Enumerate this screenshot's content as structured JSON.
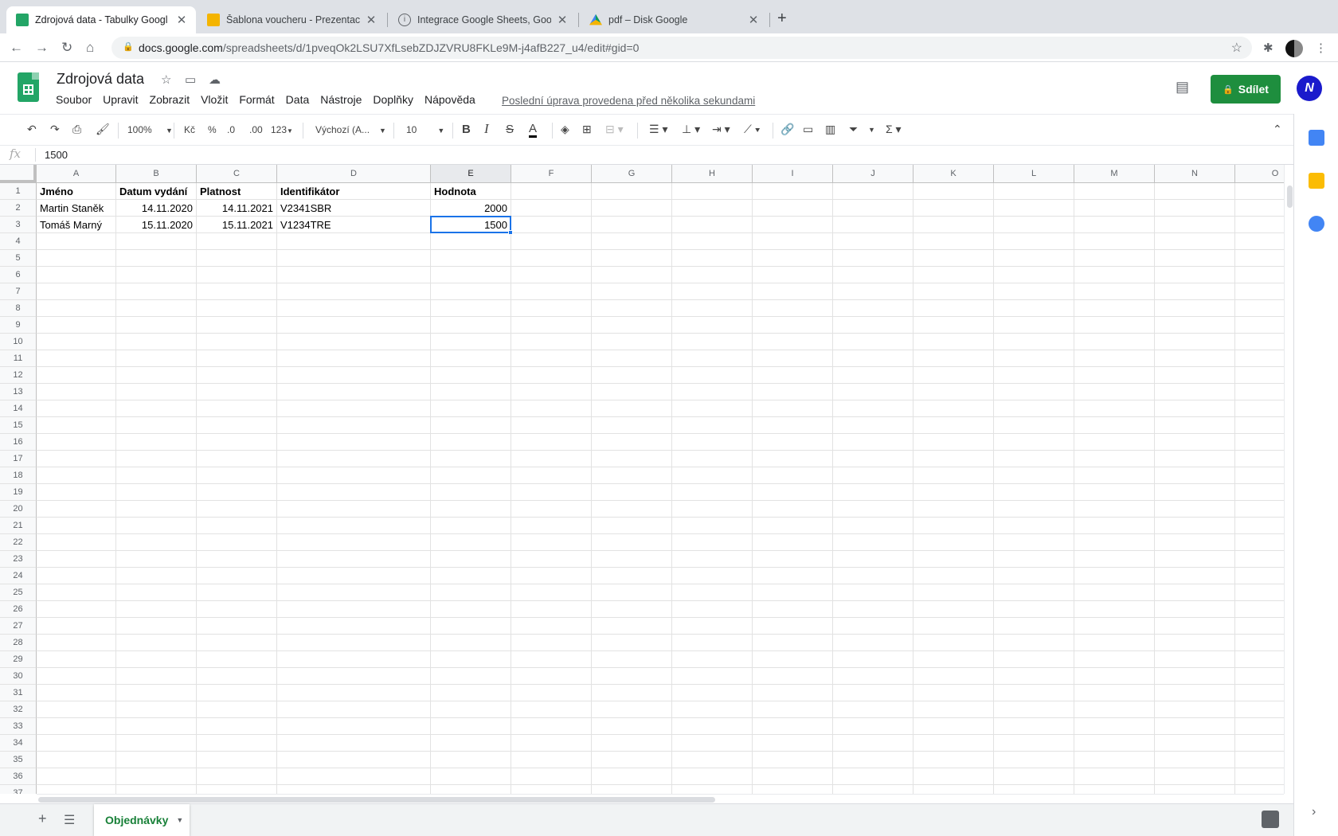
{
  "browser": {
    "tabs": [
      {
        "title": "Zdrojová data - Tabulky Googl",
        "icon": "sheets-icon",
        "active": true
      },
      {
        "title": "Šablona voucheru - Prezentac",
        "icon": "slides-icon",
        "active": false
      },
      {
        "title": "Integrace Google Sheets, Goo",
        "icon": "info-icon",
        "active": false
      },
      {
        "title": "pdf – Disk Google",
        "icon": "drive-icon",
        "active": false
      }
    ],
    "url_host": "docs.google.com",
    "url_path": "/spreadsheets/d/1pveqOk2LSU7XfLsebZDJZVRU8FKLe9M-j4afB227_u4/edit#gid=0"
  },
  "doc": {
    "title": "Zdrojová data",
    "menu": [
      "Soubor",
      "Upravit",
      "Zobrazit",
      "Vložit",
      "Formát",
      "Data",
      "Nástroje",
      "Doplňky",
      "Nápověda"
    ],
    "last_edit": "Poslední úprava provedena před několika sekundami",
    "share_label": "Sdílet",
    "avatar_letter": "N"
  },
  "toolbar": {
    "zoom": "100%",
    "currency": "Kč",
    "percent": "%",
    "dec_decrease": ".0",
    "dec_increase": ".00",
    "more_formats": "123",
    "font": "Výchozí (A...",
    "font_size": "10"
  },
  "formula_bar": {
    "fx": "fx",
    "value": "1500"
  },
  "sheet": {
    "columns": [
      "A",
      "B",
      "C",
      "D",
      "E",
      "F",
      "G",
      "H",
      "I",
      "J",
      "K",
      "L",
      "M",
      "N",
      "O"
    ],
    "selected_column": "E",
    "row_numbers": [
      "1",
      "2",
      "3",
      "4",
      "5",
      "6",
      "7",
      "8",
      "9",
      "10",
      "11",
      "12",
      "13",
      "14",
      "15",
      "16",
      "17",
      "18",
      "19",
      "20",
      "21",
      "22",
      "23",
      "24",
      "25",
      "26",
      "27",
      "28",
      "29",
      "30",
      "31",
      "32",
      "33",
      "34",
      "35",
      "36",
      "37"
    ],
    "headers": [
      "Jméno",
      "Datum vydání",
      "Platnost",
      "Identifikátor",
      "Hodnota"
    ],
    "rows": [
      [
        "Martin Staněk",
        "14.11.2020",
        "14.11.2021",
        "V2341SBR",
        "2000"
      ],
      [
        "Tomáš Marný",
        "15.11.2020",
        "15.11.2021",
        "V1234TRE",
        "1500"
      ]
    ],
    "selected_cell": "E3"
  },
  "sheet_tabs": {
    "active": "Objednávky"
  },
  "colors": {
    "accent": "#1a73e8",
    "share_green": "#1e8e3e",
    "sheets_green": "#23a566",
    "tab_green": "#188038"
  }
}
